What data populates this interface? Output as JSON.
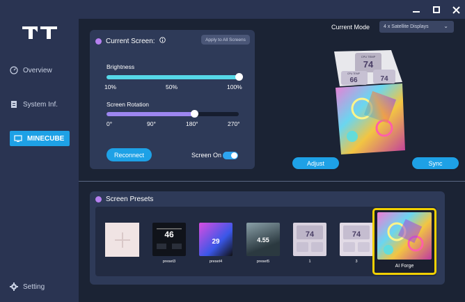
{
  "sidebar": {
    "items": [
      {
        "label": "Overview",
        "icon": "gauge-icon"
      },
      {
        "label": "System Inf.",
        "icon": "document-icon"
      },
      {
        "label": "MINECUBE",
        "icon": "monitor-icon"
      },
      {
        "label": "Setting",
        "icon": "gear-icon"
      }
    ]
  },
  "current_screen": {
    "title": "Current Screen:",
    "apply_all": "Apply to All Screens",
    "brightness": {
      "label": "Brightness",
      "ticks": [
        "10%",
        "50%",
        "100%"
      ],
      "value_percent": 100
    },
    "rotation": {
      "label": "Screen Rotation",
      "ticks": [
        "0°",
        "90°",
        "180°",
        "270°"
      ],
      "value_deg": 180
    },
    "reconnect": "Reconnect",
    "screen_on_label": "Screen On",
    "screen_on": true
  },
  "mode": {
    "label": "Current Mode",
    "selected": "4 x Satellite Displays"
  },
  "cube_buttons": {
    "adjust": "Adjust",
    "sync": "Sync"
  },
  "cube_faces": {
    "top": {
      "title": "CPU TEMP",
      "value": "74"
    },
    "left": {
      "title": "CPU TEMP",
      "value": "66"
    },
    "right": {
      "value": "74"
    }
  },
  "presets": {
    "title": "Screen Presets",
    "items": [
      {
        "caption": "preset3",
        "value": "46"
      },
      {
        "caption": "preset4",
        "value": "29"
      },
      {
        "caption": "preset5",
        "value": "4.55"
      },
      {
        "caption": "1",
        "value": "74"
      },
      {
        "caption": "3",
        "value": "74"
      },
      {
        "caption": "AI Forge",
        "value": ""
      }
    ]
  },
  "colors": {
    "accent": "#1ea1e6",
    "purple_dot": "#b680f0",
    "brightness_track": "#56d8e8",
    "rotation_track": "#9d86f0",
    "selected_border": "#f1d000"
  }
}
